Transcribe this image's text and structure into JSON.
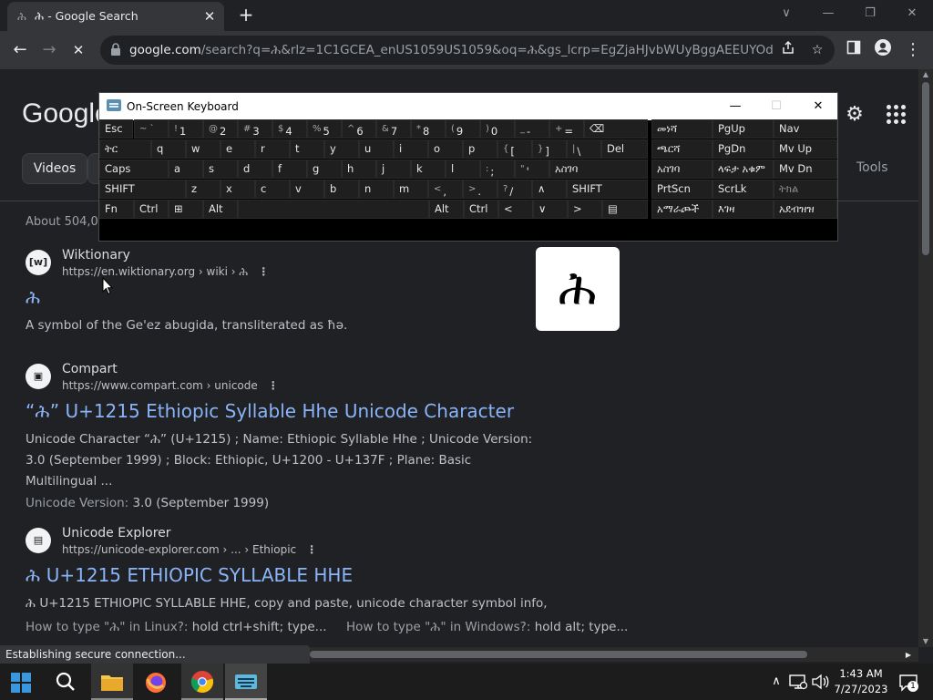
{
  "tab": {
    "favicon": "ሕ",
    "title": "ሕ - Google Search",
    "close": "✕"
  },
  "newtab": "+",
  "window_controls": {
    "minimize": "—",
    "restore": "❐",
    "close": "✕",
    "dropdown": "∨"
  },
  "toolbar": {
    "back": "←",
    "forward": "→",
    "reload": "✕",
    "url_host": "google.com",
    "url_rest": "/search?q=ሕ&rlz=1C1GCEA_enUS1059US1059&oq=ሕ&gs_lcrp=EgZjaHJvbWUyBggAEEUYOdIBCDQ..."
  },
  "page": {
    "logo": "Google",
    "chip_videos": "Videos",
    "tools": "Tools",
    "about": "About 504,00",
    "glyph_card": "ሕ"
  },
  "results": [
    {
      "favicon": "[w]",
      "site": "Wiktionary",
      "url": "https://en.wiktionary.org › wiki › ሕ",
      "title": "ሕ",
      "snippet": "A symbol of the Ge'ez abugida, transliterated as ħə."
    },
    {
      "favicon": "▣",
      "site": "Compart",
      "url": "https://www.compart.com › unicode",
      "title": "“ሕ” U+1215 Ethiopic Syllable Hhe Unicode Character",
      "snippet": "Unicode Character “ሕ” (U+1215) ; Name: Ethiopic Syllable Hhe ; Unicode Version: 3.0 (September 1999) ; Block: Ethiopic, U+1200 - U+137F ; Plane: Basic Multilingual ...",
      "extra_label": "Unicode Version:",
      "extra_value": "3.0 (September 1999)"
    },
    {
      "favicon": "▤",
      "site": "Unicode Explorer",
      "url": "https://unicode-explorer.com › ... › Ethiopic",
      "title": "ሕ U+1215 ETHIOPIC SYLLABLE HHE",
      "snippet": "ሕ U+1215 ETHIOPIC SYLLABLE HHE, copy and paste, unicode character symbol info,",
      "more1_q": "How to type \"ሕ\" in Linux?:",
      "more1_a": "hold ctrl+shift; type...",
      "more2_q": "How to type \"ሕ\" in Windows?:",
      "more2_a": "hold alt; type..."
    }
  ],
  "status": "Establishing secure connection...",
  "osk": {
    "title": "On-Screen Keyboard",
    "minimize": "—",
    "maximize": "☐",
    "close": "✕",
    "keys": [
      {
        "id": "esc",
        "l": "Esc"
      },
      {
        "id": "k1",
        "s": "~ `",
        "l": ""
      },
      {
        "id": "k2",
        "s": "!",
        "l": "1"
      },
      {
        "id": "k3",
        "s": "@",
        "l": "2"
      },
      {
        "id": "k4",
        "s": "#",
        "l": "3"
      },
      {
        "id": "k5",
        "s": "$",
        "l": "4"
      },
      {
        "id": "k6",
        "s": "%",
        "l": "5"
      },
      {
        "id": "k7",
        "s": "^",
        "l": "6"
      },
      {
        "id": "k8",
        "s": "&",
        "l": "7"
      },
      {
        "id": "k9",
        "s": "*",
        "l": "8"
      },
      {
        "id": "k10",
        "s": "(",
        "l": "9"
      },
      {
        "id": "k11",
        "s": ")",
        "l": "0"
      },
      {
        "id": "k12",
        "s": "_",
        "l": "-"
      },
      {
        "id": "k13",
        "s": "+",
        "l": "="
      },
      {
        "id": "bksp",
        "l": "⌫"
      },
      {
        "id": "tab",
        "l": "ትር"
      },
      {
        "id": "q",
        "l": "q"
      },
      {
        "id": "w",
        "l": "w"
      },
      {
        "id": "e",
        "l": "e"
      },
      {
        "id": "r",
        "l": "r"
      },
      {
        "id": "t",
        "l": "t"
      },
      {
        "id": "y",
        "l": "y"
      },
      {
        "id": "u",
        "l": "u"
      },
      {
        "id": "i",
        "l": "i"
      },
      {
        "id": "o",
        "l": "o"
      },
      {
        "id": "p",
        "l": "p"
      },
      {
        "id": "lb",
        "s": "{",
        "l": "["
      },
      {
        "id": "rb",
        "s": "}",
        "l": "]"
      },
      {
        "id": "bs",
        "s": "|",
        "l": "\\"
      },
      {
        "id": "del",
        "l": "Del"
      },
      {
        "id": "caps",
        "l": "Caps"
      },
      {
        "id": "a",
        "l": "a"
      },
      {
        "id": "s",
        "l": "s"
      },
      {
        "id": "d",
        "l": "d"
      },
      {
        "id": "f",
        "l": "f"
      },
      {
        "id": "g",
        "l": "g"
      },
      {
        "id": "h",
        "l": "h"
      },
      {
        "id": "j",
        "l": "j"
      },
      {
        "id": "k",
        "l": "k"
      },
      {
        "id": "l",
        "l": "l"
      },
      {
        "id": "semi",
        "s": ":",
        "l": ";"
      },
      {
        "id": "quote",
        "s": "\"",
        "l": "'"
      },
      {
        "id": "enter",
        "l": "አስገባ"
      },
      {
        "id": "lshift",
        "l": "SHIFT"
      },
      {
        "id": "z",
        "l": "z"
      },
      {
        "id": "x",
        "l": "x"
      },
      {
        "id": "c",
        "l": "c"
      },
      {
        "id": "v",
        "l": "v"
      },
      {
        "id": "b",
        "l": "b"
      },
      {
        "id": "n",
        "l": "n"
      },
      {
        "id": "m",
        "l": "m"
      },
      {
        "id": "comma",
        "s": "<",
        "l": ","
      },
      {
        "id": "period",
        "s": ">",
        "l": "."
      },
      {
        "id": "slash",
        "s": "?",
        "l": "/"
      },
      {
        "id": "uparrow",
        "l": "∧"
      },
      {
        "id": "rshift",
        "l": "SHIFT"
      },
      {
        "id": "fn",
        "l": "Fn"
      },
      {
        "id": "lctrl",
        "l": "Ctrl"
      },
      {
        "id": "win",
        "l": "⊞"
      },
      {
        "id": "lalt",
        "l": "Alt"
      },
      {
        "id": "space",
        "l": ""
      },
      {
        "id": "ralt",
        "l": "Alt"
      },
      {
        "id": "rctrl",
        "l": "Ctrl"
      },
      {
        "id": "left",
        "l": "<"
      },
      {
        "id": "down",
        "l": "∨"
      },
      {
        "id": "right",
        "l": ">"
      },
      {
        "id": "menu",
        "l": "▤"
      },
      {
        "id": "home",
        "l": "መነሻ"
      },
      {
        "id": "pgup",
        "l": "PgUp"
      },
      {
        "id": "nav",
        "l": "Nav"
      },
      {
        "id": "end",
        "l": "ጫርሻ"
      },
      {
        "id": "pgdn",
        "l": "PgDn"
      },
      {
        "id": "mvup",
        "l": "Mv Up"
      },
      {
        "id": "insert",
        "l": "አስገባ"
      },
      {
        "id": "pause",
        "l": "ላፍታ አቁም"
      },
      {
        "id": "mvdn",
        "l": "Mv Dn"
      },
      {
        "id": "prtscn",
        "l": "PrtScn"
      },
      {
        "id": "scrlk",
        "l": "ScrLk"
      },
      {
        "id": "dock",
        "l": "ትክል"
      },
      {
        "id": "options",
        "l": "አማራጮች"
      },
      {
        "id": "help",
        "l": "እገዛ"
      },
      {
        "id": "fade",
        "l": "አደብዝዝ"
      }
    ]
  },
  "taskbar": {
    "time": "1:43 AM",
    "date": "7/27/2023",
    "notif_count": "1",
    "tray_chevron": "∧"
  },
  "colors": {
    "link": "#8ab4f8",
    "bg": "#202124",
    "chrome": "#35363a"
  }
}
